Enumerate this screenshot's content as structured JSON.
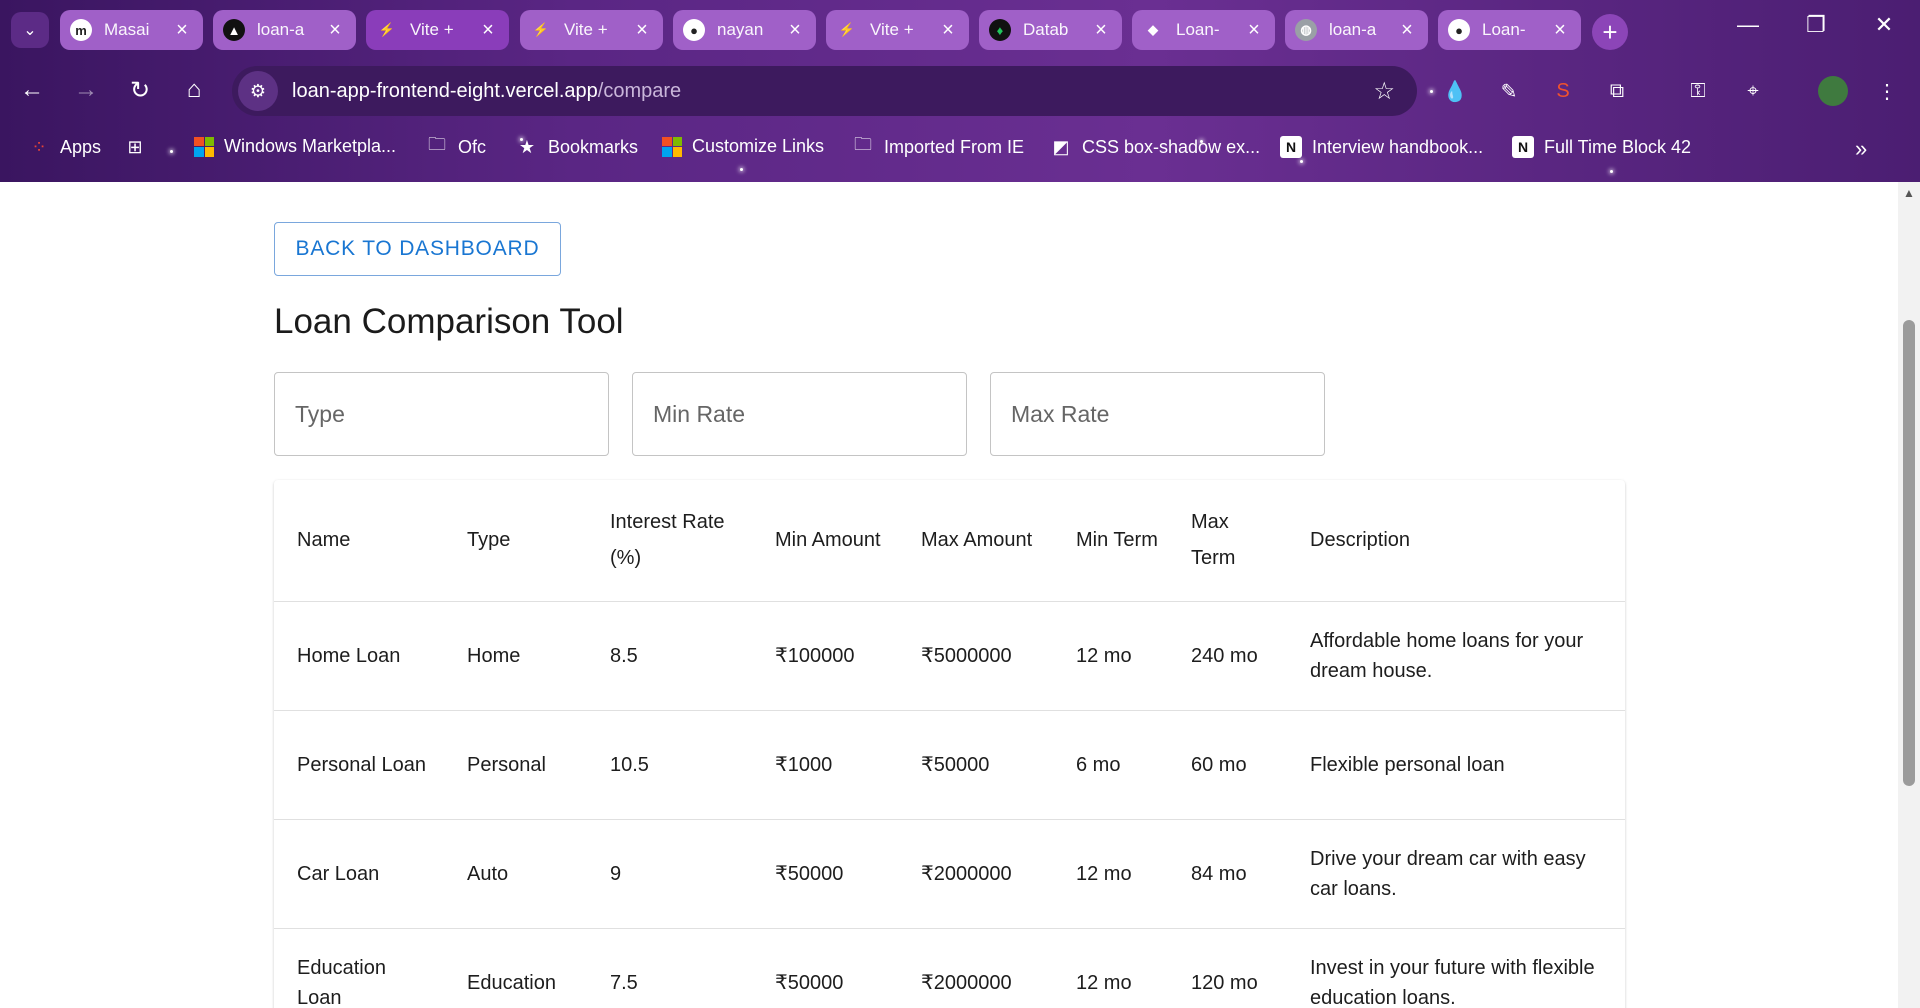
{
  "browser": {
    "tabs": [
      {
        "title": "Masai",
        "icon": "masai-icon"
      },
      {
        "title": "loan-a",
        "icon": "vercel-icon"
      },
      {
        "title": "Vite +",
        "icon": "vite-icon"
      },
      {
        "title": "Vite +",
        "icon": "vite-icon"
      },
      {
        "title": "nayan",
        "icon": "github-icon"
      },
      {
        "title": "Vite +",
        "icon": "vite-icon"
      },
      {
        "title": "Datab",
        "icon": "mongodb-icon"
      },
      {
        "title": "Loan-",
        "icon": "render-icon"
      },
      {
        "title": "loan-a",
        "icon": "globe-icon"
      },
      {
        "title": "Loan-",
        "icon": "github-icon"
      }
    ],
    "active_tab_index": 2,
    "url_host": "loan-app-frontend-eight.vercel.app",
    "url_path": "/compare",
    "bookmarks": [
      "Apps",
      "Windows Marketpla...",
      "Ofc",
      "Bookmarks",
      "Customize Links",
      "Imported From IE",
      "CSS box-shadow ex...",
      "Interview handbook...",
      "Full Time Block 42"
    ]
  },
  "page": {
    "back_button": "BACK TO DASHBOARD",
    "title": "Loan Comparison Tool",
    "filters": {
      "type_placeholder": "Type",
      "min_rate_placeholder": "Min Rate",
      "max_rate_placeholder": "Max Rate"
    },
    "table": {
      "headers": [
        "Name",
        "Type",
        "Interest Rate (%)",
        "Min Amount",
        "Max Amount",
        "Min Term",
        "Max Term",
        "Description"
      ],
      "rows": [
        [
          "Home Loan",
          "Home",
          "8.5",
          "₹100000",
          "₹5000000",
          "12 mo",
          "240 mo",
          "Affordable home loans for your dream house."
        ],
        [
          "Personal Loan",
          "Personal",
          "10.5",
          "₹1000",
          "₹50000",
          "6 mo",
          "60 mo",
          "Flexible personal loan"
        ],
        [
          "Car Loan",
          "Auto",
          "9",
          "₹50000",
          "₹2000000",
          "12 mo",
          "84 mo",
          "Drive your dream car with easy car loans."
        ],
        [
          "Education Loan",
          "Education",
          "7.5",
          "₹50000",
          "₹2000000",
          "12 mo",
          "120 mo",
          "Invest in your future with flexible education loans."
        ]
      ]
    }
  }
}
